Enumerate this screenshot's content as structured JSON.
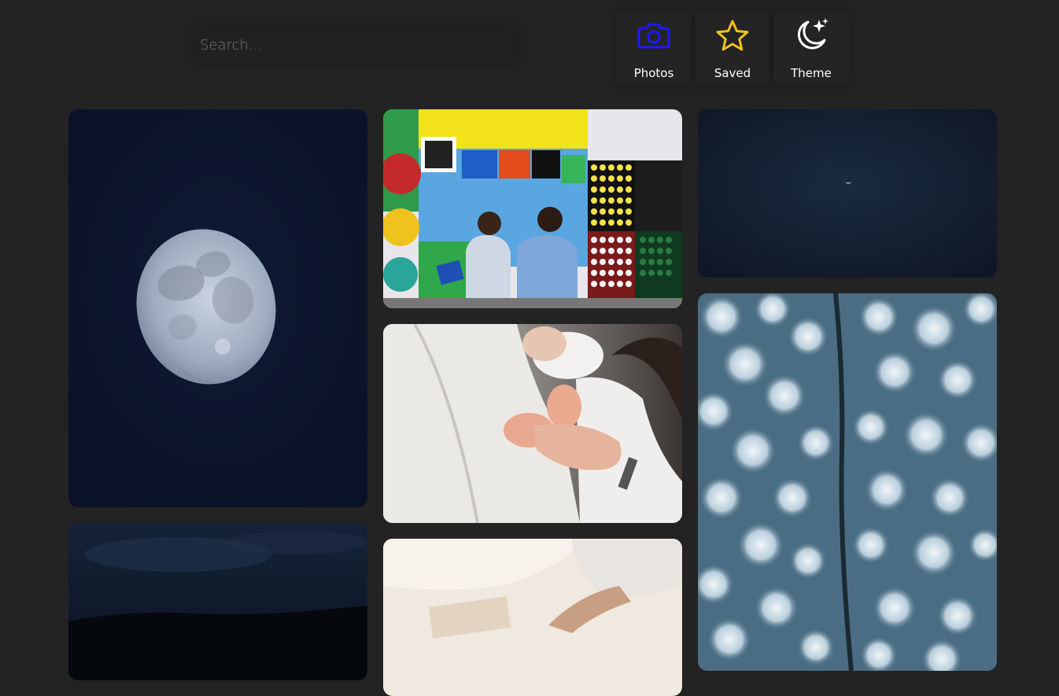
{
  "search": {
    "placeholder": "Search..."
  },
  "nav": {
    "photos": {
      "label": "Photos",
      "icon": "camera-icon",
      "color": "#1a1aff"
    },
    "saved": {
      "label": "Saved",
      "icon": "star-icon",
      "color": "#f2c21b"
    },
    "theme": {
      "label": "Theme",
      "icon": "moon-stars-icon",
      "color": "#ffffff"
    }
  },
  "colors": {
    "background": "#232323",
    "card_shadow": "#1a1a1a"
  },
  "gallery": {
    "photos": [
      {
        "subject": "moon"
      },
      {
        "subject": "mural-couple"
      },
      {
        "subject": "night-sky-crescent"
      },
      {
        "subject": "newborn-feet-in-hands"
      },
      {
        "subject": "snowy-forest-road-aerial"
      },
      {
        "subject": "night-landscape"
      },
      {
        "subject": "white-linen-hands"
      }
    ]
  }
}
